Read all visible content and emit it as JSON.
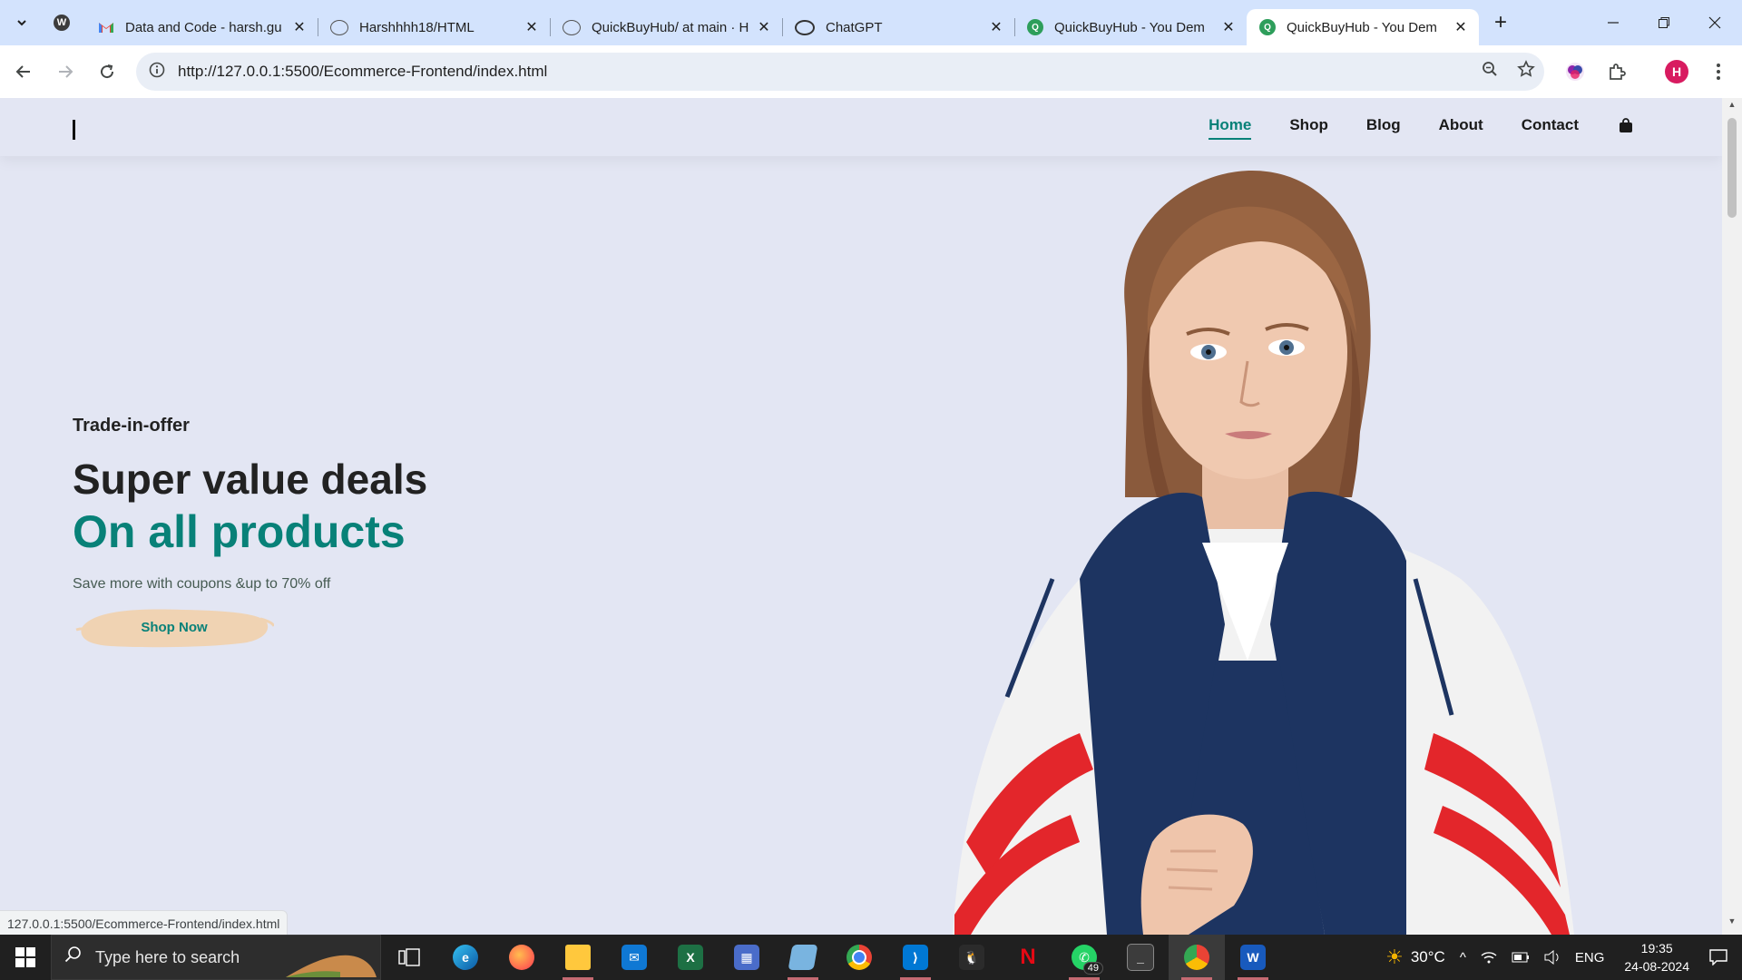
{
  "browser": {
    "tabs": [
      {
        "title": "Data and Code - harsh.gu",
        "icon": "gmail-icon"
      },
      {
        "title": "Harshhhh18/HTML",
        "icon": "github-icon"
      },
      {
        "title": "QuickBuyHub/ at main · H",
        "icon": "github-icon"
      },
      {
        "title": "ChatGPT",
        "icon": "chatgpt-icon"
      },
      {
        "title": "QuickBuyHub - You Dem",
        "icon": "quickbuyhub-icon"
      },
      {
        "title": "QuickBuyHub - You Dem",
        "icon": "quickbuyhub-icon",
        "active": true
      }
    ],
    "url": "http://127.0.0.1:5500/Ecommerce-Frontend/index.html",
    "profile_initial": "H",
    "status_url": "127.0.0.1:5500/Ecommerce-Frontend/index.html"
  },
  "site": {
    "nav": {
      "home": "Home",
      "shop": "Shop",
      "blog": "Blog",
      "about": "About",
      "contact": "Contact"
    },
    "hero": {
      "eyebrow": "Trade-in-offer",
      "headline": "Super value deals",
      "subheadline": "On all products",
      "description": "Save more with coupons &up to 70% off",
      "cta": "Shop Now"
    },
    "colors": {
      "accent": "#088178",
      "background": "#e3e6f3",
      "cta_brush": "#f2d5b5"
    }
  },
  "taskbar": {
    "search_placeholder": "Type here to search",
    "weather": "30°C",
    "language": "ENG",
    "time": "19:35",
    "date": "24-08-2024",
    "whatsapp_badge": "49"
  }
}
